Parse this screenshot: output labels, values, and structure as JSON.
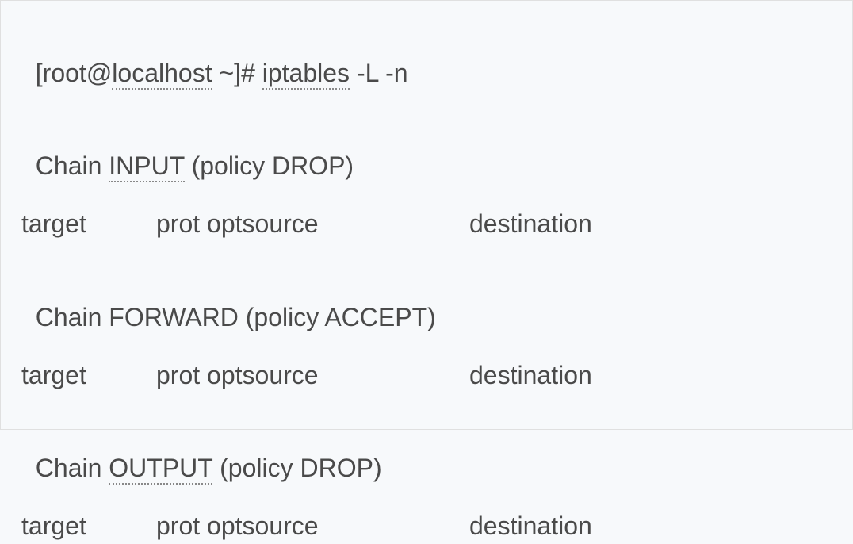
{
  "prompt": {
    "user": "root",
    "host": "localhost",
    "cwd": "~",
    "symbol": "#",
    "command": "iptables",
    "args": "-L -n"
  },
  "chains": [
    {
      "name": "INPUT",
      "policy": "DROP",
      "underline_name": true
    },
    {
      "name": "FORWARD",
      "policy": "ACCEPT",
      "underline_name": false
    },
    {
      "name": "OUTPUT",
      "policy": "DROP",
      "underline_name": true
    }
  ],
  "columns": {
    "target": "target",
    "prot": "prot optsource",
    "destination": "destination"
  },
  "labels": {
    "chain": "Chain",
    "policy": "policy"
  }
}
